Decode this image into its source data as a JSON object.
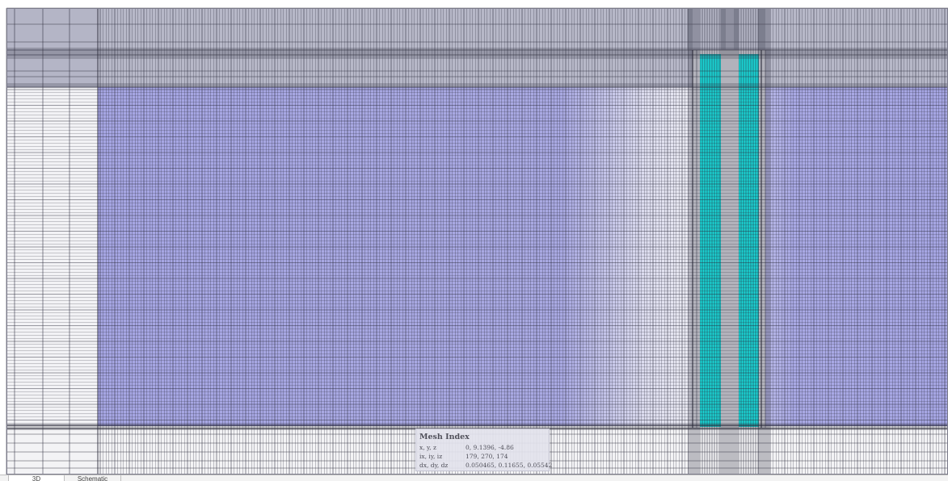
{
  "tooltip": {
    "title": "Mesh Index",
    "rows": [
      {
        "label": "x, y, z",
        "value": "0, 9.1396, -4.86"
      },
      {
        "label": "ix, iy, iz",
        "value": "179, 270, 174"
      },
      {
        "label": "dx, dy, dz",
        "value": "0.050465, 0.11655, 0.05542"
      }
    ]
  },
  "tabs": [
    {
      "label": "3D",
      "active": true
    },
    {
      "label": "Schematic",
      "active": false
    }
  ],
  "colors": {
    "dielectric_blue": "#a6a6e3",
    "cladding_gray": "#b7b8c6",
    "core_cyan": "#19d5d5",
    "grid_line": "#2a2a3a"
  }
}
